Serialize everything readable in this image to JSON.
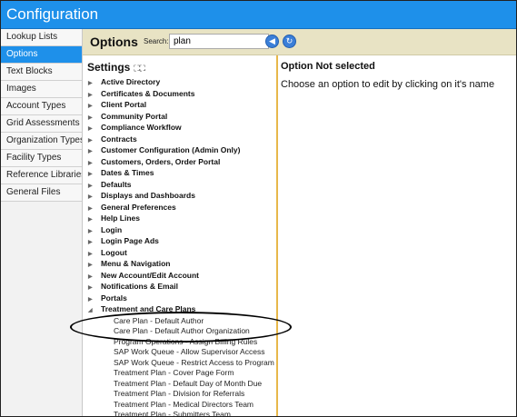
{
  "app": {
    "title": "Configuration"
  },
  "sidebar": {
    "items": [
      {
        "label": "Lookup Lists",
        "active": false
      },
      {
        "label": "Options",
        "active": true
      },
      {
        "label": "Text Blocks",
        "active": false
      },
      {
        "label": "Images",
        "active": false
      },
      {
        "label": "Account Types",
        "active": false
      },
      {
        "label": "Grid Assessments",
        "active": false
      },
      {
        "label": "Organization Types",
        "active": false
      },
      {
        "label": "Facility Types",
        "active": false
      },
      {
        "label": "Reference Libraries",
        "active": false
      },
      {
        "label": "General Files",
        "active": false
      }
    ]
  },
  "header": {
    "title": "Options",
    "search_label": "Search:",
    "search_value": "plan"
  },
  "tree": {
    "title": "Settings",
    "expand_icons": "⛶⛶",
    "nodes": [
      "Active Directory",
      "Certificates & Documents",
      "Client Portal",
      "Community Portal",
      "Compliance Workflow",
      "Contracts",
      "Customer Configuration (Admin Only)",
      "Customers, Orders, Order Portal",
      "Dates & Times",
      "Defaults",
      "Displays and Dashboards",
      "General Preferences",
      "Help Lines",
      "Login",
      "Login Page Ads",
      "Logout",
      "Menu & Navigation",
      "New Account/Edit Account",
      "Notifications & Email",
      "Portals",
      "Treatment and Care Plans"
    ],
    "leaves": [
      "Care Plan - Default Author",
      "Care Plan - Default Author Organization",
      "Program Operations - Assign Billing Rules",
      "SAP Work Queue - Allow Supervisor Access",
      "SAP Work Queue - Restrict Access to Program St",
      "Treatment Plan - Cover Page Form",
      "Treatment Plan - Default Day of Month Due",
      "Treatment Plan - Division for Referrals",
      "Treatment Plan - Medical Directors Team",
      "Treatment Plan - Submitters Team"
    ]
  },
  "detail": {
    "heading": "Option Not selected",
    "message": "Choose an option to edit by clicking on it's name"
  }
}
